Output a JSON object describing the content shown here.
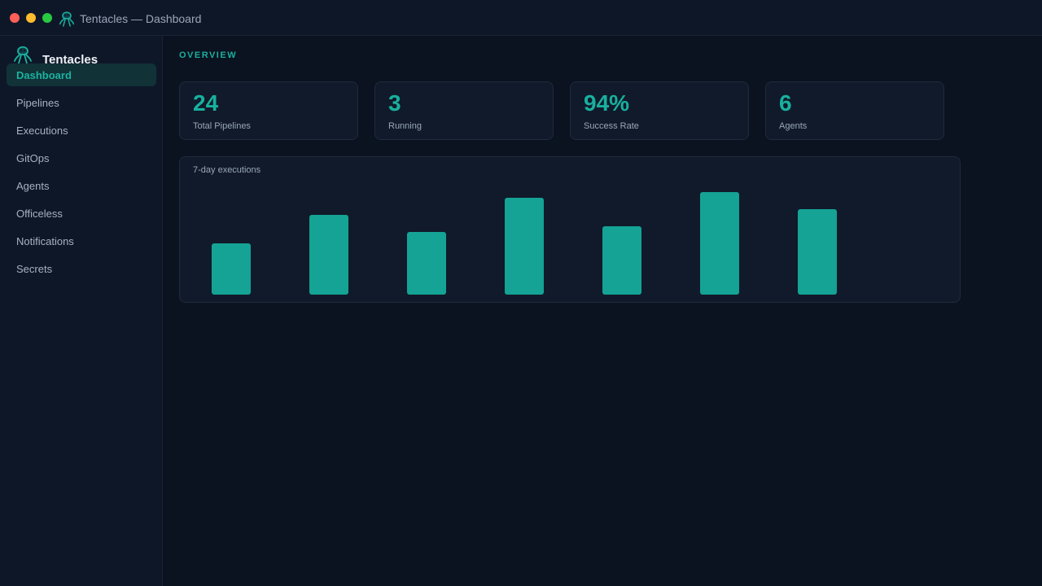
{
  "window": {
    "title": "Tentacles — Dashboard"
  },
  "sidebar": {
    "brand": "Tentacles",
    "items": [
      {
        "label": "Dashboard",
        "active": true
      },
      {
        "label": "Pipelines",
        "active": false
      },
      {
        "label": "Executions",
        "active": false
      },
      {
        "label": "GitOps",
        "active": false
      },
      {
        "label": "Agents",
        "active": false
      },
      {
        "label": "Officeless",
        "active": false
      },
      {
        "label": "Notifications",
        "active": false
      },
      {
        "label": "Secrets",
        "active": false
      }
    ]
  },
  "main": {
    "section": "OVERVIEW",
    "stats": [
      {
        "value": "24",
        "label": "Total Pipelines"
      },
      {
        "value": "3",
        "label": "Running"
      },
      {
        "value": "94%",
        "label": "Success Rate"
      },
      {
        "value": "6",
        "label": "Agents"
      }
    ],
    "chart_title": "7-day executions"
  },
  "colors": {
    "accent": "#18b09e",
    "bar": "#14a394",
    "background": "#0b1220",
    "panel": "#101a2a"
  },
  "icons": {
    "logo": "octopus-icon"
  },
  "chart_data": {
    "type": "bar",
    "title": "7-day executions",
    "categories": [
      "",
      "",
      "",
      "",
      "",
      "",
      ""
    ],
    "values": [
      63,
      98,
      77,
      119,
      84,
      126,
      105
    ],
    "ylim": [
      0,
      140
    ],
    "grid": false,
    "legend": "none",
    "xlabel": "",
    "ylabel": ""
  }
}
